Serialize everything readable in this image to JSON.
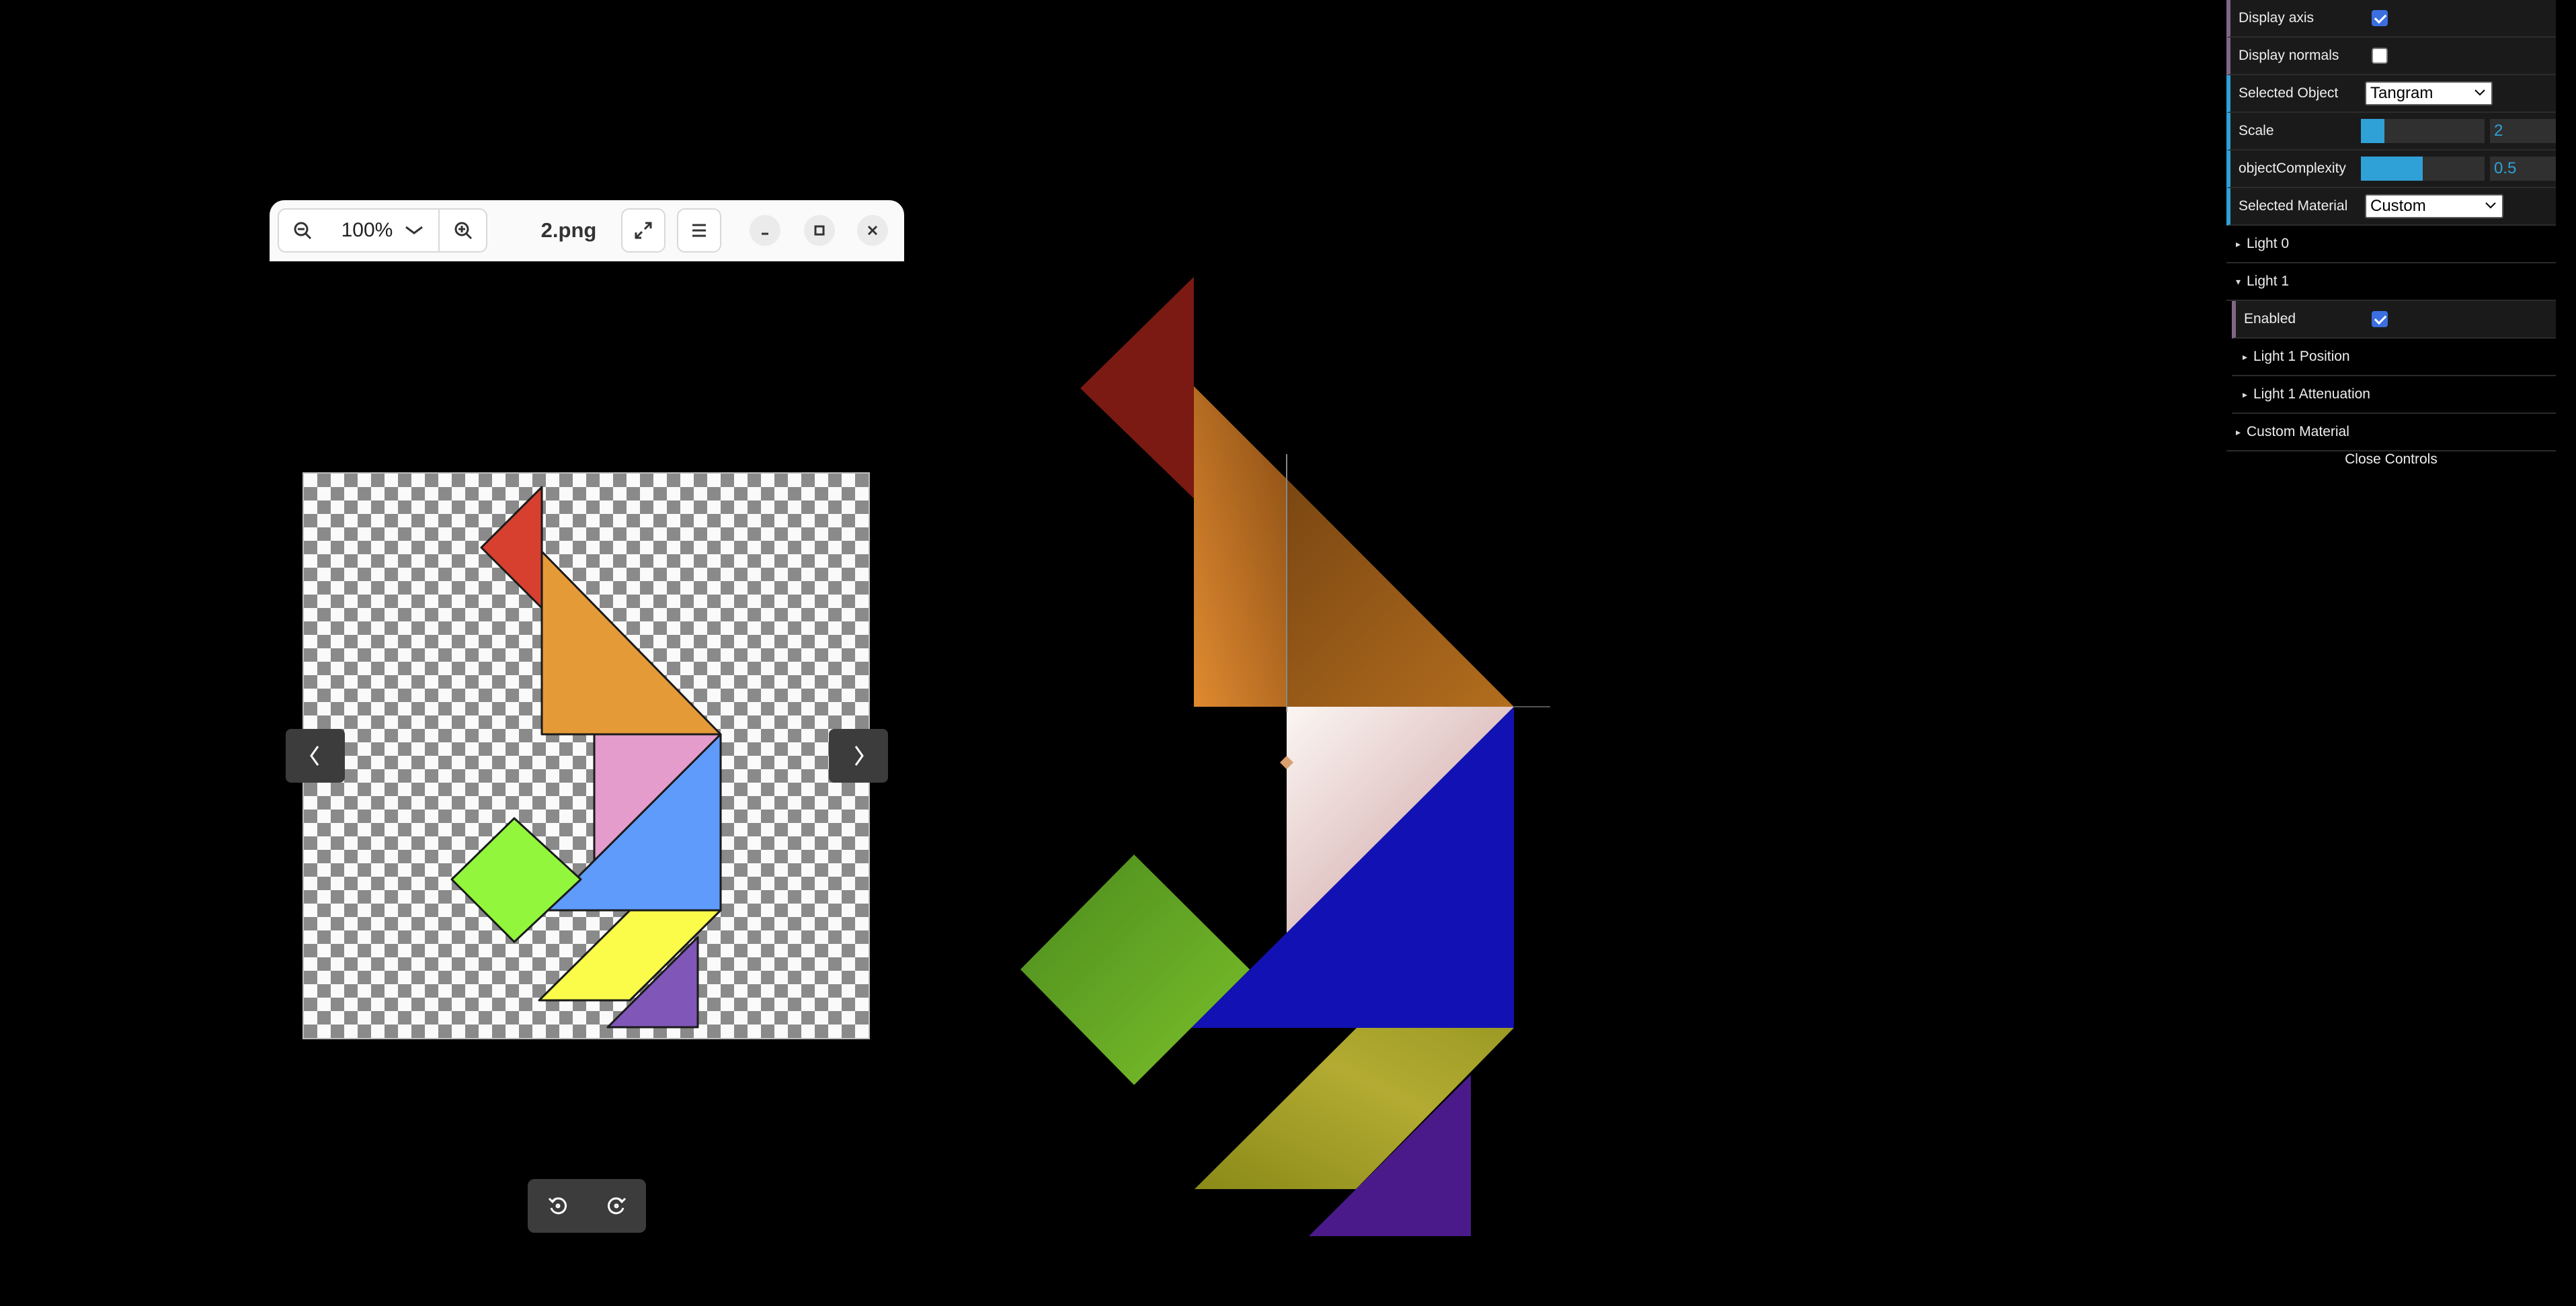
{
  "viewer": {
    "zoom_level": "100%",
    "file_name": "2.png",
    "icons": {
      "zoom_out": "zoom-out-icon",
      "zoom_in": "zoom-in-icon",
      "fullscreen": "expand-icon",
      "menu": "hamburger-menu-icon",
      "minimize": "minimize-icon",
      "maximize": "maximize-icon",
      "close": "close-icon",
      "prev": "chevron-left-icon",
      "next": "chevron-right-icon",
      "rotate_left": "rotate-left-icon",
      "rotate_right": "rotate-right-icon"
    }
  },
  "tangram_colors": {
    "red": "#d7402f",
    "orange": "#e59a38",
    "pink": "#e39ccb",
    "blue": "#5f9bfb",
    "green": "#92f73c",
    "yellow": "#fbfb4a",
    "purple": "#8056b8"
  },
  "controls": {
    "display_axis": {
      "label": "Display axis",
      "checked": true
    },
    "display_normals": {
      "label": "Display normals",
      "checked": false
    },
    "selected_object": {
      "label": "Selected Object",
      "value": "Tangram"
    },
    "scale": {
      "label": "Scale",
      "value": "2",
      "fraction": 0.19
    },
    "object_complexity": {
      "label": "objectComplexity",
      "value": "0.5",
      "fraction": 0.5
    },
    "selected_material": {
      "label": "Selected Material",
      "value": "Custom"
    },
    "folders": {
      "light0": "Light 0",
      "light1": "Light 1",
      "light1_enabled": {
        "label": "Enabled",
        "checked": true
      },
      "light1_position": "Light 1 Position",
      "light1_attenuation": "Light 1 Attenuation",
      "custom_material": "Custom Material"
    },
    "close_label": "Close Controls"
  }
}
